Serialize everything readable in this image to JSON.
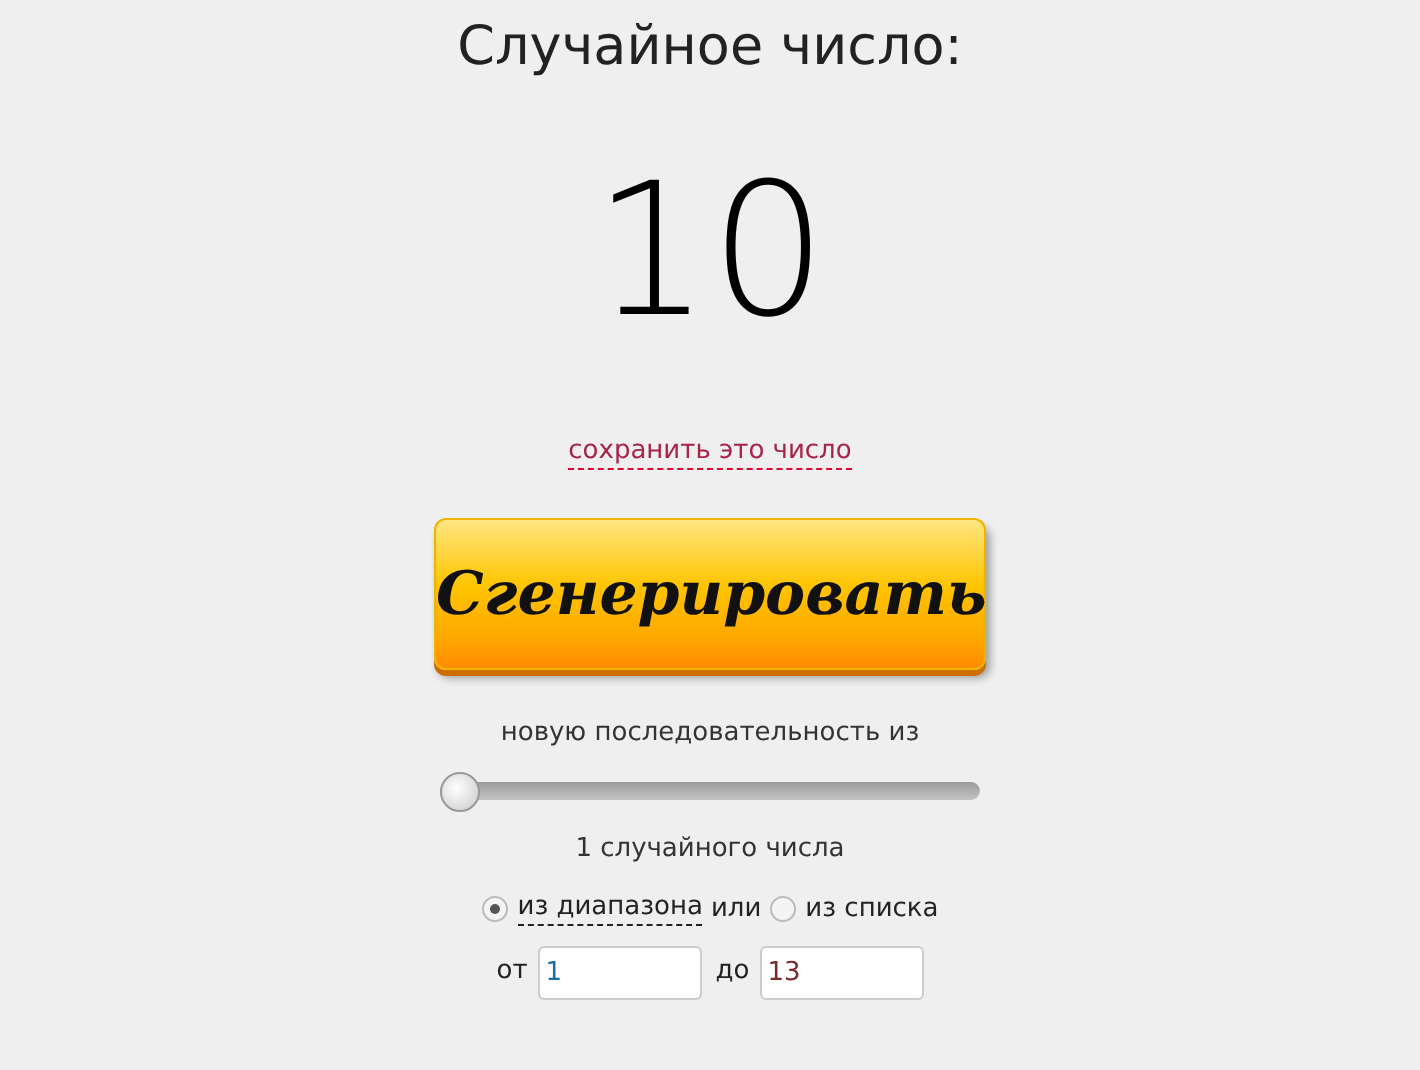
{
  "title": "Случайное число:",
  "result": "10",
  "save_link": "сохранить это число",
  "generate_button": "Сгенерировать",
  "sequence_label": "новую последовательность из",
  "slider": {
    "level": 0
  },
  "count_text": "1 случайного числа",
  "sources": [
    {
      "label": "из диапазона",
      "selected": true
    },
    {
      "label": "из списка",
      "selected": false
    }
  ],
  "sources_joiner": "или",
  "range": {
    "from_label": "от",
    "from_value": "1",
    "to_label": "до",
    "to_value": "13"
  }
}
